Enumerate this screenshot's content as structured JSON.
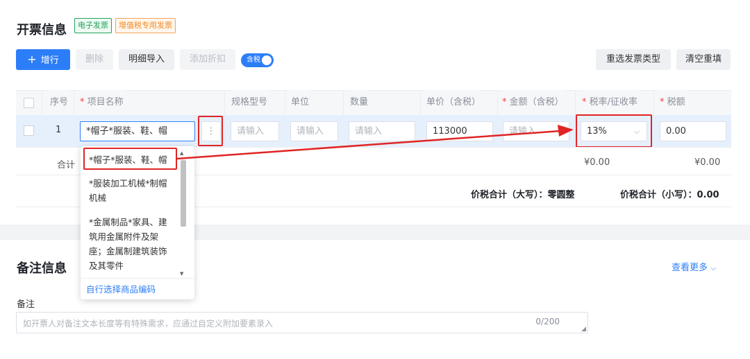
{
  "invoice_section": {
    "title": "开票信息",
    "tags": [
      "电子发票",
      "增值税专用发票"
    ],
    "toolbar": {
      "add_row": "增行",
      "delete": "删除",
      "import_detail": "明细导入",
      "add_discount": "添加折扣",
      "tax_toggle": "含税",
      "reselect_type": "重选发票类型",
      "clear_refill": "清空重填"
    },
    "table": {
      "headers": [
        "序号",
        "项目名称",
        "规格型号",
        "单位",
        "数量",
        "单价（含税）",
        "金额（含税）",
        "税率/征收率",
        "税额"
      ],
      "required_mark": "*",
      "row": {
        "index": "1",
        "item_name": "*帽子*服装、鞋、帽",
        "spec_placeholder": "请输入",
        "unit_placeholder": "请输入",
        "qty_placeholder": "请输入",
        "unit_price": "113000",
        "amount_placeholder": "请输入",
        "tax_rate": "13%",
        "tax_amount": "0.00"
      },
      "total_row": {
        "label": "合计",
        "amount_total": "¥0.00",
        "tax_total": "¥0.00"
      },
      "sum_upper_label": "价税合计（大写）：",
      "sum_upper_value": "零圆整",
      "sum_lower_label": "价税合计（小写）：",
      "sum_lower_value": "0.00"
    },
    "item_dropdown": {
      "options": [
        "*帽子*服装、鞋、帽",
        "*服装加工机械*制帽机械",
        "*金属制品*家具、建筑用金属附件及架座；金属制建筑装饰及其零件"
      ],
      "footer_link": "自行选择商品编码"
    }
  },
  "remark_section": {
    "title": "备注信息",
    "view_more": "查看更多",
    "field_label": "备注",
    "placeholder": "如开票人对备注文本长度等有特殊需求，应通过自定义附加要素录入",
    "counter": "0/200"
  },
  "colors": {
    "primary": "#2c7ef8",
    "annotation_red": "#e02424",
    "selected_row": "#e6f0fd"
  }
}
